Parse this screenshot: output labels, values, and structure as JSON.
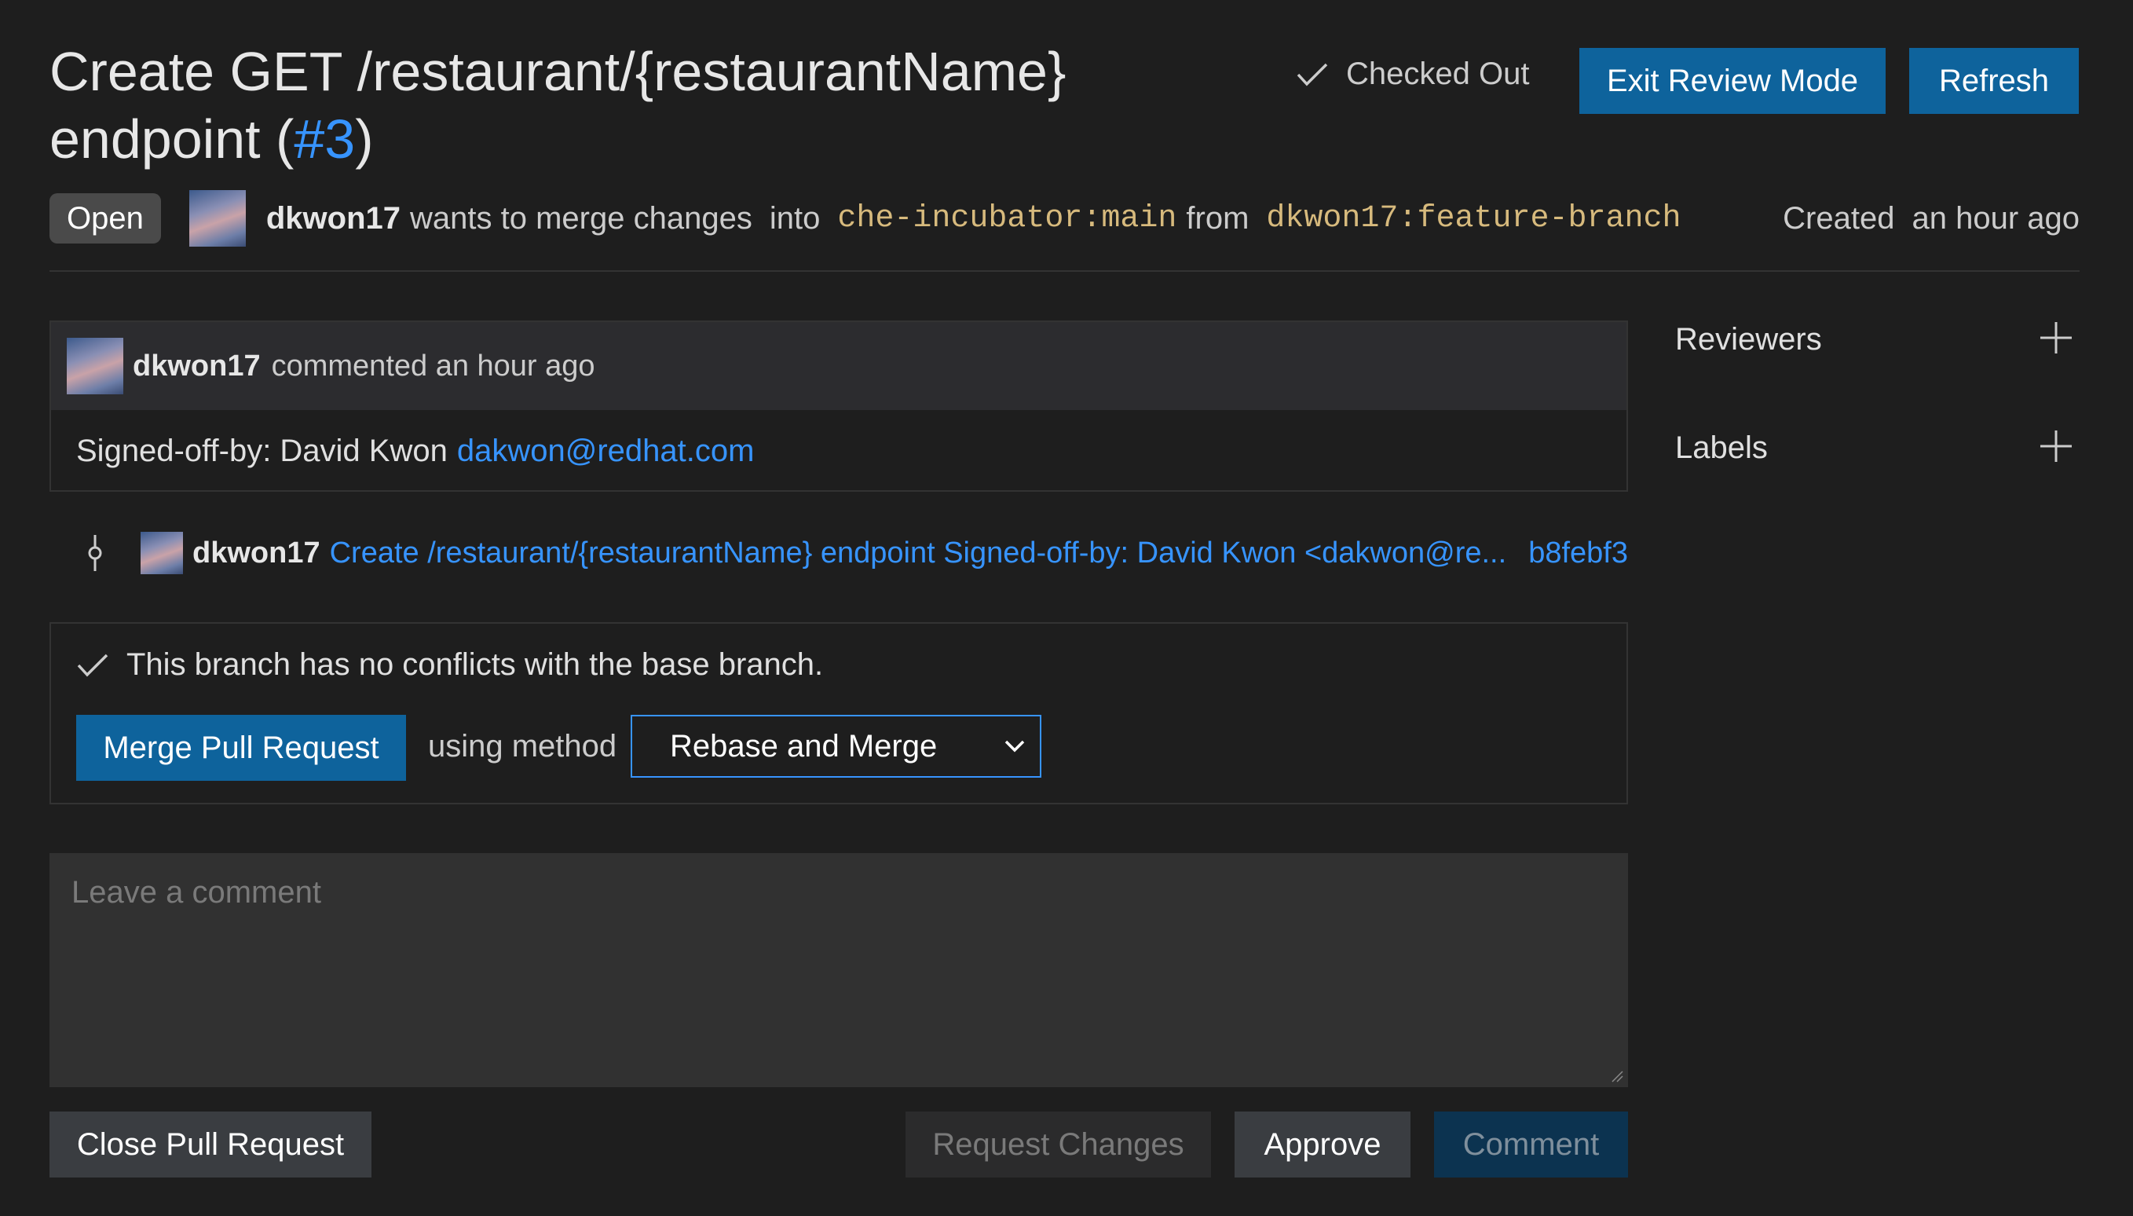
{
  "header": {
    "title_text": "Create GET /restaurant/{restaurantName} endpoint (",
    "pr_number": "#3",
    "title_close": ")",
    "checked_out_label": "Checked Out",
    "exit_review_label": "Exit Review Mode",
    "refresh_label": "Refresh"
  },
  "status": {
    "badge": "Open",
    "author": "dkwon17",
    "merge_text": "wants to merge changes",
    "into_text": "into",
    "base_branch": "che-incubator:main",
    "from_text": "from",
    "head_branch": "dkwon17:feature-branch",
    "created_label": "Created",
    "created_time": "an hour ago"
  },
  "comment": {
    "author": "dkwon17",
    "meta": "commented an hour ago",
    "body_text": "Signed-off-by: David Kwon",
    "body_email": "dakwon@redhat.com"
  },
  "commit": {
    "author": "dkwon17",
    "message": "Create /restaurant/{restaurantName} endpoint Signed-off-by: David Kwon <dakwon@re...",
    "sha": "b8febf3"
  },
  "merge": {
    "status_text": "This branch has no conflicts with the base branch.",
    "merge_button": "Merge Pull Request",
    "using_method": "using method",
    "method_selected": "Rebase and Merge"
  },
  "comment_input": {
    "placeholder": "Leave a comment"
  },
  "actions": {
    "close_pr": "Close Pull Request",
    "request_changes": "Request Changes",
    "approve": "Approve",
    "comment": "Comment"
  },
  "sidebar": {
    "reviewers_label": "Reviewers",
    "labels_label": "Labels"
  },
  "colors": {
    "background": "#1e1e1e",
    "primary_button": "#0e639c",
    "link": "#3794ff",
    "branch": "#d7ba7d"
  }
}
